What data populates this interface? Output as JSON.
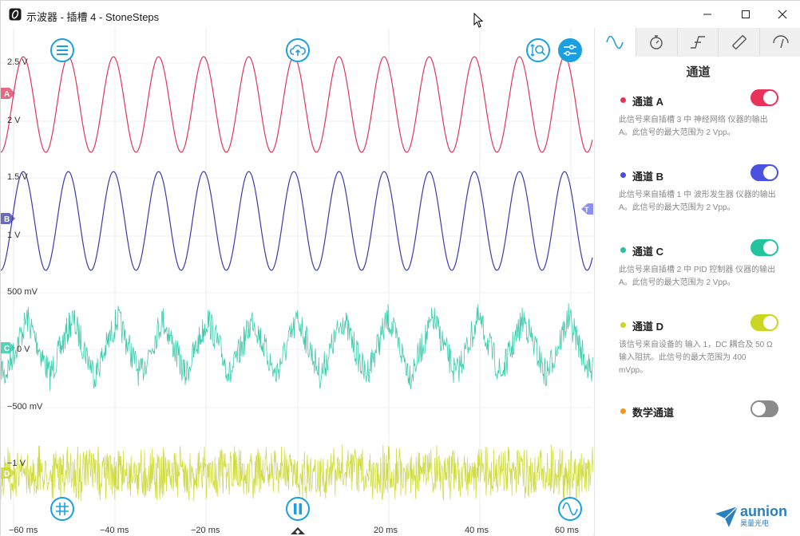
{
  "window": {
    "title": "示波器 - 插槽 4 - StoneSteps"
  },
  "plot": {
    "y_labels": [
      "2.5 V",
      "2 V",
      "1.5 V",
      "1 V",
      "500 mV",
      "0 V",
      "−500 mV",
      "−1 V"
    ],
    "x_labels": [
      "−60 ms",
      "−40 ms",
      "−20 ms",
      "20 ms",
      "40 ms",
      "60 ms"
    ],
    "channel_markers": [
      "A",
      "B",
      "C",
      "D"
    ],
    "trigger_marker": "T",
    "colors": {
      "A": "#e0355a",
      "B": "#3a3ab0",
      "C": "#1fc4a0",
      "D": "#c9d623"
    },
    "toolbar_icons": [
      "menu-icon",
      "cloud-upload-icon",
      "zoom-fit-icon",
      "settings-sliders-icon",
      "grid-icon",
      "pause-icon",
      "waveform-icon"
    ]
  },
  "panel": {
    "tabs": [
      "channels-tab-icon",
      "timer-tab-icon",
      "trigger-tab-icon",
      "ruler-tab-icon",
      "gauge-tab-icon"
    ],
    "title": "通道",
    "channels": [
      {
        "name": "通道 A",
        "color": "#e8325a",
        "on": true,
        "desc": "此信号来自插槽 3 中 神经网络 仪器的输出 A。此信号的最大范围为 2 Vpp。"
      },
      {
        "name": "通道 B",
        "color": "#4a50e0",
        "on": true,
        "desc": "此信号来自插槽 1 中 波形发生器 仪器的输出 A。此信号的最大范围为 2 Vpp。"
      },
      {
        "name": "通道 C",
        "color": "#22c4a0",
        "on": true,
        "desc": "此信号来自插槽 2 中 PID 控制器 仪器的输出 A。此信号的最大范围为 2 Vpp。"
      },
      {
        "name": "通道 D",
        "color": "#c9d623",
        "on": true,
        "desc": "该信号来自设备的 输入 1，DC 耦合及 50 Ω 输入阻抗。此信号的最大范围为 400 mVpp。"
      },
      {
        "name": "数学通道",
        "color": "#f39a1e",
        "on": false,
        "desc": ""
      }
    ],
    "logo_name": "aunion",
    "logo_sub": "昊量光电"
  }
}
